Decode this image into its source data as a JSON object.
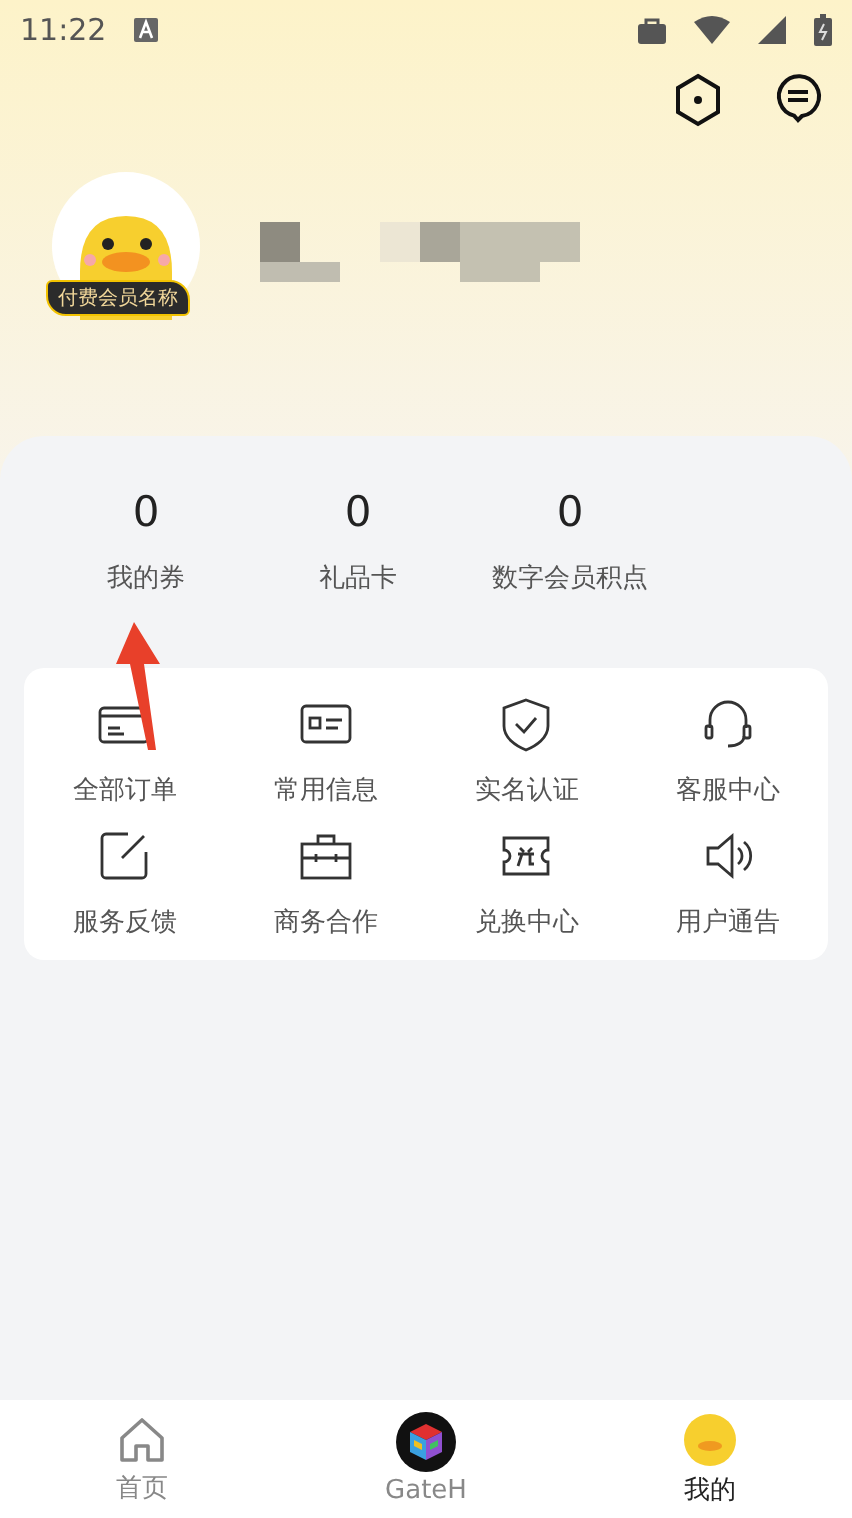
{
  "status_bar": {
    "time": "11:22"
  },
  "profile": {
    "badge": "付费会员名称"
  },
  "stats": [
    {
      "value": "0",
      "label": "我的券"
    },
    {
      "value": "0",
      "label": "礼品卡"
    },
    {
      "value": "0",
      "label": "数字会员积点"
    }
  ],
  "menu": [
    {
      "kind": "card",
      "label": "全部订单"
    },
    {
      "kind": "idcard",
      "label": "常用信息"
    },
    {
      "kind": "shield",
      "label": "实名认证"
    },
    {
      "kind": "headset",
      "label": "客服中心"
    },
    {
      "kind": "edit",
      "label": "服务反馈"
    },
    {
      "kind": "briefcase",
      "label": "商务合作"
    },
    {
      "kind": "ticket",
      "label": "兑换中心"
    },
    {
      "kind": "speaker",
      "label": "用户通告"
    }
  ],
  "bottom_nav": [
    {
      "kind": "home",
      "label": "首页",
      "selected": false
    },
    {
      "kind": "cube",
      "label": "GateH",
      "selected": false
    },
    {
      "kind": "duck",
      "label": "我的",
      "selected": true
    }
  ]
}
